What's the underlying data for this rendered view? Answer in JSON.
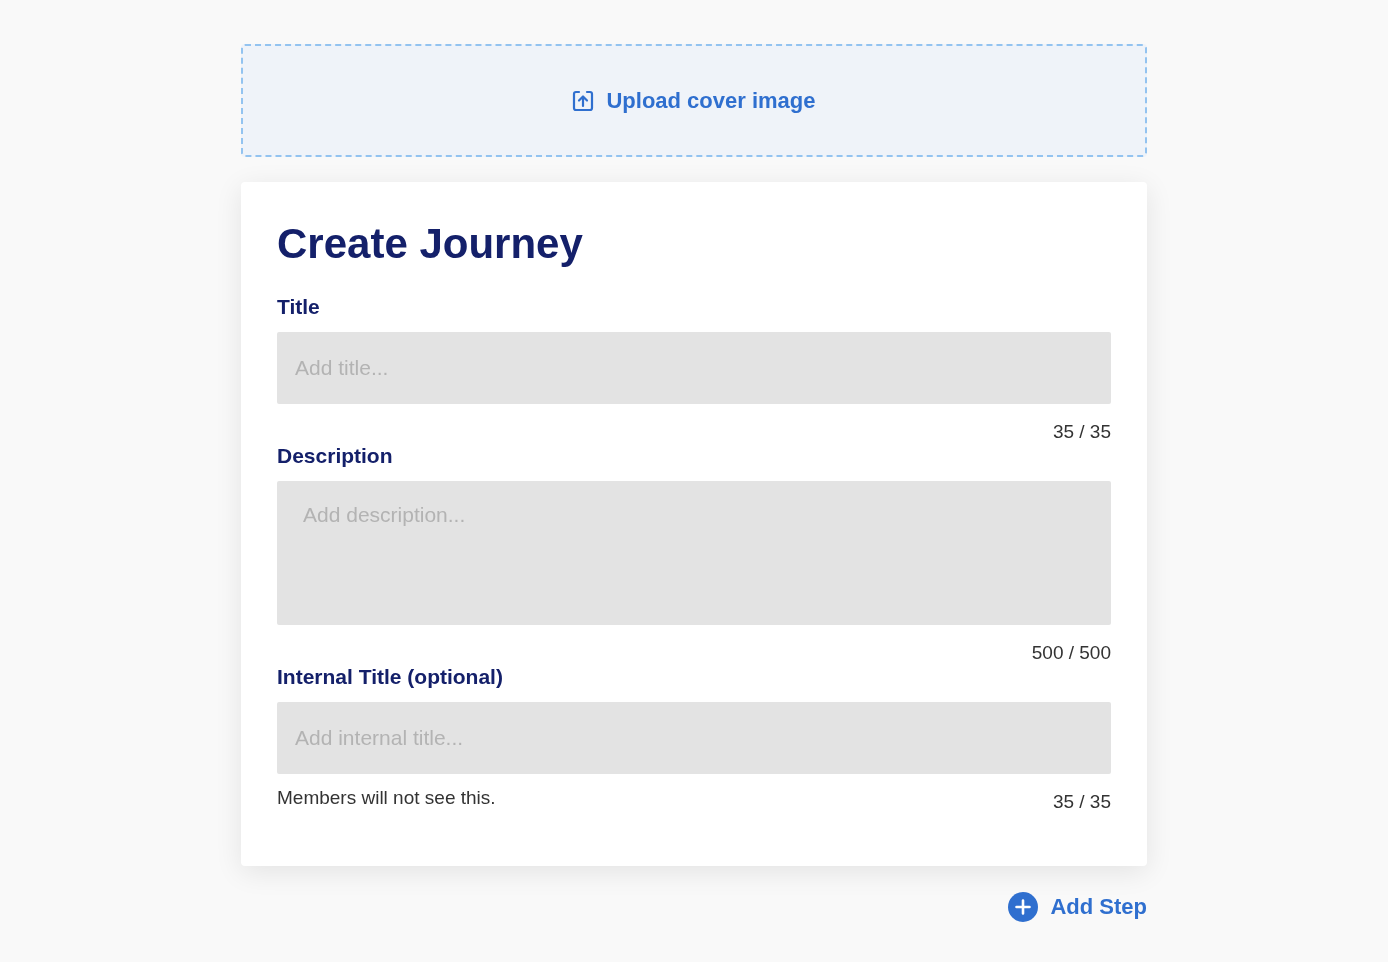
{
  "upload": {
    "label": "Upload cover image"
  },
  "form": {
    "heading": "Create Journey",
    "fields": [
      {
        "kind": "input",
        "label": "Title",
        "placeholder": "Add title...",
        "counter": "35 / 35"
      },
      {
        "kind": "textarea",
        "label": "Description",
        "placeholder": "Add description...",
        "counter": "500 / 500"
      },
      {
        "kind": "input",
        "label": "Internal Title (optional)",
        "placeholder": "Add internal title...",
        "hint": "Members will not see this.",
        "counter": "35 / 35"
      }
    ]
  },
  "add_step": {
    "label": "Add Step"
  }
}
